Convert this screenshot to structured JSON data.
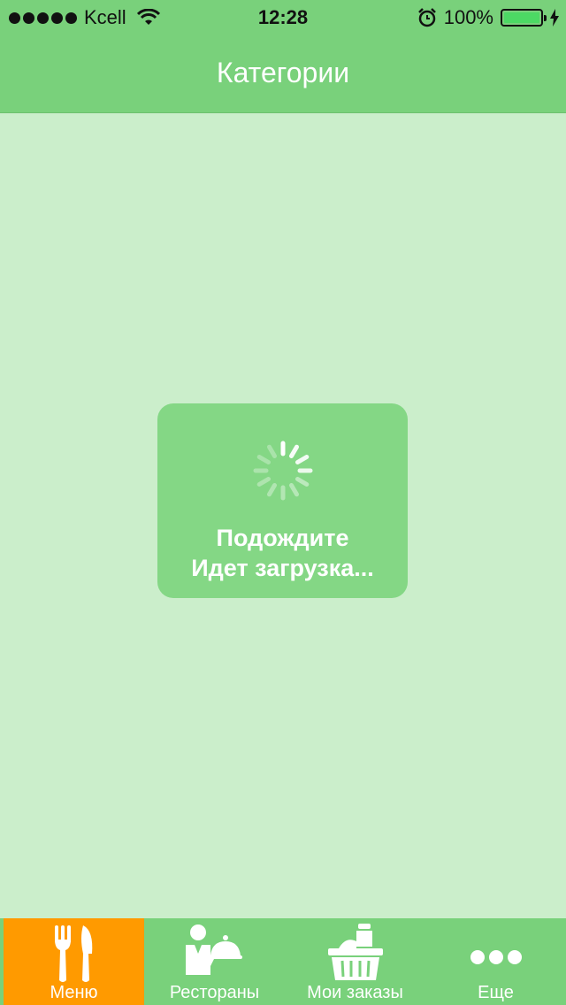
{
  "status_bar": {
    "carrier": "Kcell",
    "time": "12:28",
    "battery": "100%"
  },
  "nav": {
    "title": "Категории"
  },
  "loading": {
    "line1": "Подождите",
    "line2": "Идет загрузка..."
  },
  "tabs": [
    {
      "label": "Меню",
      "icon": "fork-knife-icon",
      "active": true
    },
    {
      "label": "Рестораны",
      "icon": "waiter-icon",
      "active": false
    },
    {
      "label": "Мои заказы",
      "icon": "basket-icon",
      "active": false
    },
    {
      "label": "Еще",
      "icon": "more-dots-icon",
      "active": false
    }
  ],
  "colors": {
    "bar": "#79d17b",
    "background": "#cbeecb",
    "active_tab": "#ff9a00"
  }
}
